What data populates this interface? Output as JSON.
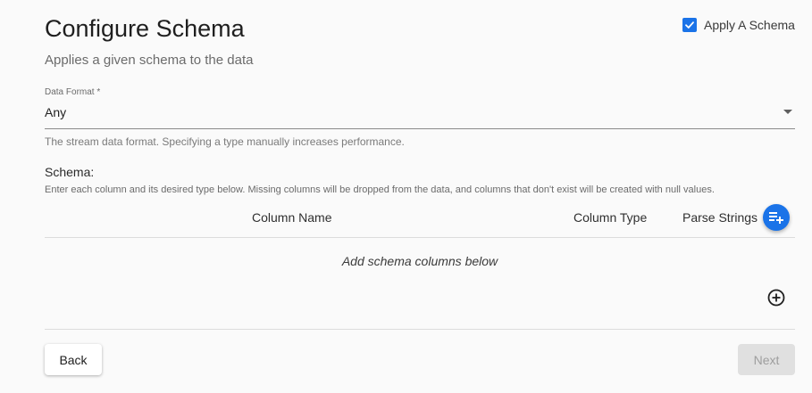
{
  "header": {
    "title": "Configure Schema",
    "subtitle": "Applies a given schema to the data"
  },
  "apply_schema": {
    "label": "Apply A Schema",
    "checked": true
  },
  "data_format": {
    "label": "Data Format *",
    "value": "Any",
    "helper": "The stream data format. Specifying a type manually increases performance."
  },
  "schema": {
    "label": "Schema:",
    "description": "Enter each column and its desired type below. Missing columns will be dropped from the data, and columns that don't exist will be created with null values.",
    "columns": [
      "Column Name",
      "Column Type",
      "Parse Strings"
    ],
    "empty_message": "Add schema columns below"
  },
  "footer": {
    "back_label": "Back",
    "next_label": "Next"
  },
  "colors": {
    "accent": "#1a73e8",
    "disabled_bg": "#e0e0e0",
    "disabled_text": "#9e9e9e"
  },
  "icons": {
    "checkbox": "checkmark-icon",
    "dropdown": "chevron-down-icon",
    "add_list": "playlist-add-icon",
    "add_column": "add-circle-outline-icon"
  }
}
